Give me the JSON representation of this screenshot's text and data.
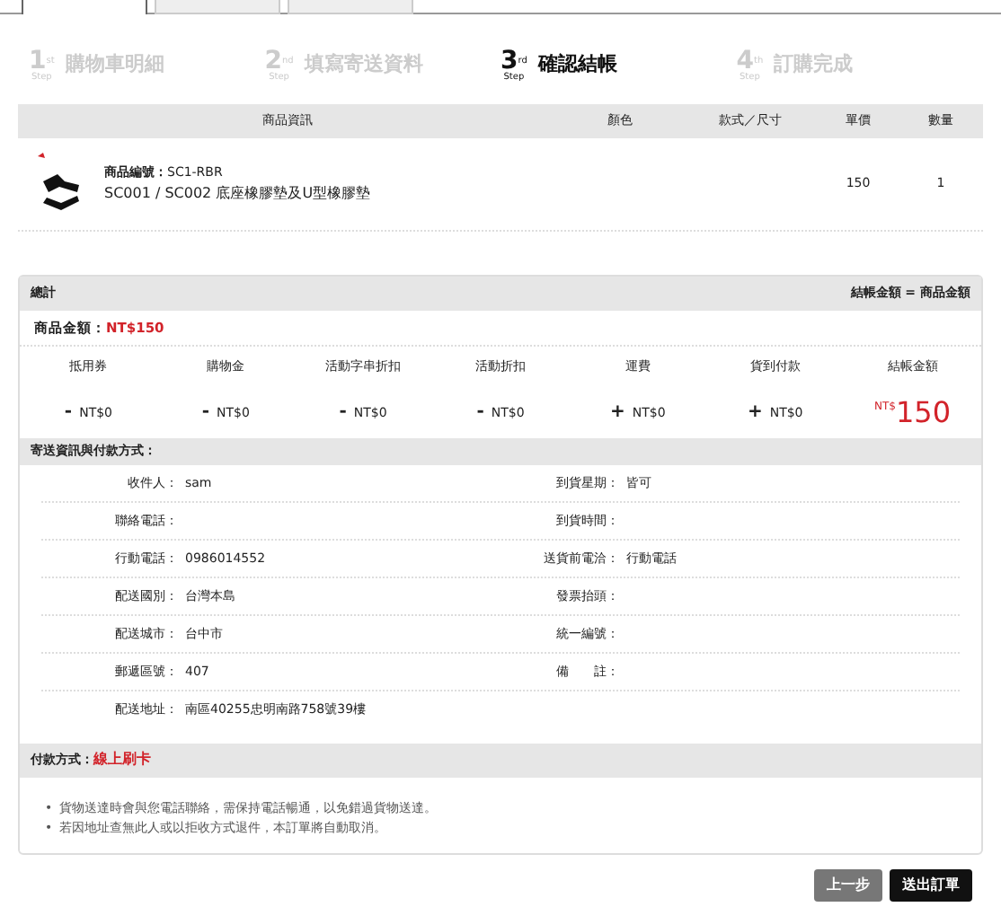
{
  "tabs": [
    {
      "selected": true
    },
    {
      "selected": false
    },
    {
      "selected": false
    }
  ],
  "steps": [
    {
      "number": "1",
      "suffix": "st",
      "step": "Step",
      "label": "購物車明細",
      "selected": false
    },
    {
      "number": "2",
      "suffix": "nd",
      "step": "Step",
      "label": "填寫寄送資料",
      "selected": false
    },
    {
      "number": "3",
      "suffix": "rd",
      "step": "Step",
      "label": "確認結帳",
      "selected": true
    },
    {
      "number": "4",
      "suffix": "th",
      "step": "Step",
      "label": "訂購完成",
      "selected": false
    }
  ],
  "cart": {
    "columns": [
      "商品資訊",
      "顏色",
      "款式／尺寸",
      "單價",
      "數量"
    ],
    "rows": [
      {
        "code_label": "商品編號：",
        "code": "SC1-RBR",
        "name": "SC001 / SC002 底座橡膠墊及U型橡膠墊",
        "price": "150",
        "quantity": "1"
      }
    ]
  },
  "summary": {
    "title": "總計",
    "formula": "結帳金額 = 商品金額",
    "goods_label": "商品金額：",
    "goods_amount": "NT$150",
    "items": [
      {
        "label": "抵用券",
        "sign": "-",
        "value": "NT$0"
      },
      {
        "label": "購物金",
        "sign": "-",
        "value": "NT$0"
      },
      {
        "label": "活動字串折扣",
        "sign": "-",
        "value": "NT$0"
      },
      {
        "label": "活動折扣",
        "sign": "-",
        "value": "NT$0"
      },
      {
        "label": "運費",
        "sign": "+",
        "value": "NT$0"
      },
      {
        "label": "貨到付款",
        "sign": "+",
        "value": "NT$0"
      }
    ],
    "total_label": "結帳金額",
    "total_currency": "NT$",
    "total_value": "150"
  },
  "shipping": {
    "title": "寄送資訊與付款方式：",
    "rows": [
      [
        {
          "label": "收件人：",
          "value": "sam"
        },
        {
          "label": "到貨星期：",
          "value": "皆可"
        }
      ],
      [
        {
          "label": "聯絡電話："
        },
        {
          "label": "到貨時間："
        }
      ],
      [
        {
          "label": "行動電話：",
          "value": "0986014552"
        },
        {
          "label": "送貨前電洽：",
          "value": "行動電話"
        }
      ],
      [
        {
          "label": "配送國別：",
          "value": "台灣本島"
        },
        {
          "label": "發票抬頭："
        }
      ],
      [
        {
          "label": "配送城市：",
          "value": "台中市"
        },
        {
          "label": "統一編號："
        }
      ],
      [
        {
          "label": "郵遞區號：",
          "value": "407"
        },
        {
          "label": "備　　註："
        }
      ],
      [
        {
          "label": "配送地址：",
          "value": "南區40255忠明南路758號39樓"
        }
      ]
    ]
  },
  "payment": {
    "label": "付款方式：",
    "value": "線上刷卡"
  },
  "notes": [
    {
      "marker": "•",
      "text": "貨物送達時會與您電話聯絡，需保持電話暢通，以免錯過貨物送達。"
    },
    {
      "marker": "•",
      "text": "若因地址查無此人或以拒收方式退件，本訂單將自動取消。"
    }
  ],
  "buttons": [
    {
      "label": "上一步",
      "kind": "secondary"
    },
    {
      "label": "送出訂單",
      "kind": "primary"
    }
  ]
}
